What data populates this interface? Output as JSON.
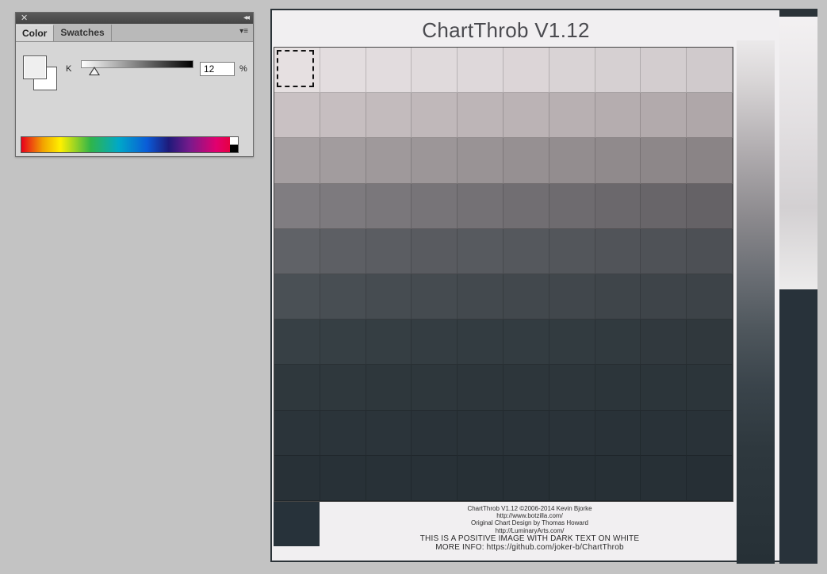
{
  "panel": {
    "tabs": [
      "Color",
      "Swatches"
    ],
    "active_tab": "Color",
    "channel_label": "K",
    "channel_value": "12",
    "percent_label": "%",
    "k_level": 0.12,
    "close_glyph": "✕",
    "collapse_glyph": "◂◂",
    "menu_glyph": "▾≡",
    "colors": {
      "foreground": "#efefef",
      "background": "#ffffff"
    }
  },
  "document": {
    "title": "ChartThrob V1.12",
    "footer_lines": [
      "ChartThrob V1.12 ©2006-2014 Kevin Bjorke",
      "http://www.botzilla.com/",
      "Original Chart Design by Thomas Howard",
      "http://LuminaryArts.com/",
      "THIS IS A POSITIVE IMAGE WITH DARK TEXT ON WHITE",
      "MORE INFO: https://github.com/joker-b/ChartThrob"
    ],
    "grid_row_colors": [
      [
        "#e6e0e1",
        "#e3dddf",
        "#e2dcde",
        "#e0dadc",
        "#ded8da",
        "#dcd5d7",
        "#d9d3d5",
        "#d6d0d2",
        "#d3cdcf",
        "#d0cacc"
      ],
      [
        "#c9c1c3",
        "#c6bec0",
        "#c3bbbd",
        "#c0b8ba",
        "#bdb5b7",
        "#bbb3b5",
        "#b8b0b2",
        "#b5adaf",
        "#b2aaac",
        "#afa7a9"
      ],
      [
        "#a59fa1",
        "#a29c9e",
        "#9f999b",
        "#9c9698",
        "#999395",
        "#969092",
        "#938d8f",
        "#908a8c",
        "#8d8789",
        "#8a8486"
      ],
      [
        "#807d81",
        "#7d7a7e",
        "#7a777b",
        "#777478",
        "#747175",
        "#716e72",
        "#6e6b6f",
        "#6b686c",
        "#686569",
        "#656266"
      ],
      [
        "#606267",
        "#5d5f64",
        "#5b5d62",
        "#595b60",
        "#575a5f",
        "#55585d",
        "#53565b",
        "#515459",
        "#4f5257",
        "#4d5055"
      ],
      [
        "#4a5055",
        "#484e53",
        "#464c51",
        "#454b50",
        "#43494e",
        "#42484d",
        "#41474c",
        "#3f454a",
        "#3e4449",
        "#3d4348"
      ],
      [
        "#374045",
        "#363f44",
        "#353e43",
        "#343d42",
        "#333c41",
        "#333c41",
        "#323b40",
        "#313a3f",
        "#31393e",
        "#30383d"
      ],
      [
        "#2f383d",
        "#2f383d",
        "#2e373c",
        "#2e373c",
        "#2d363b",
        "#2d363b",
        "#2d363b",
        "#2c353a",
        "#2c353a",
        "#2c353a"
      ],
      [
        "#2b343a",
        "#2b343a",
        "#2b343a",
        "#2a3339",
        "#2a3339",
        "#2a3339",
        "#2a3339",
        "#293238",
        "#293238",
        "#293238"
      ],
      [
        "#283137",
        "#283137",
        "#283137",
        "#283137",
        "#273036",
        "#273036",
        "#273036",
        "#273036",
        "#273036",
        "#262f35"
      ]
    ]
  }
}
